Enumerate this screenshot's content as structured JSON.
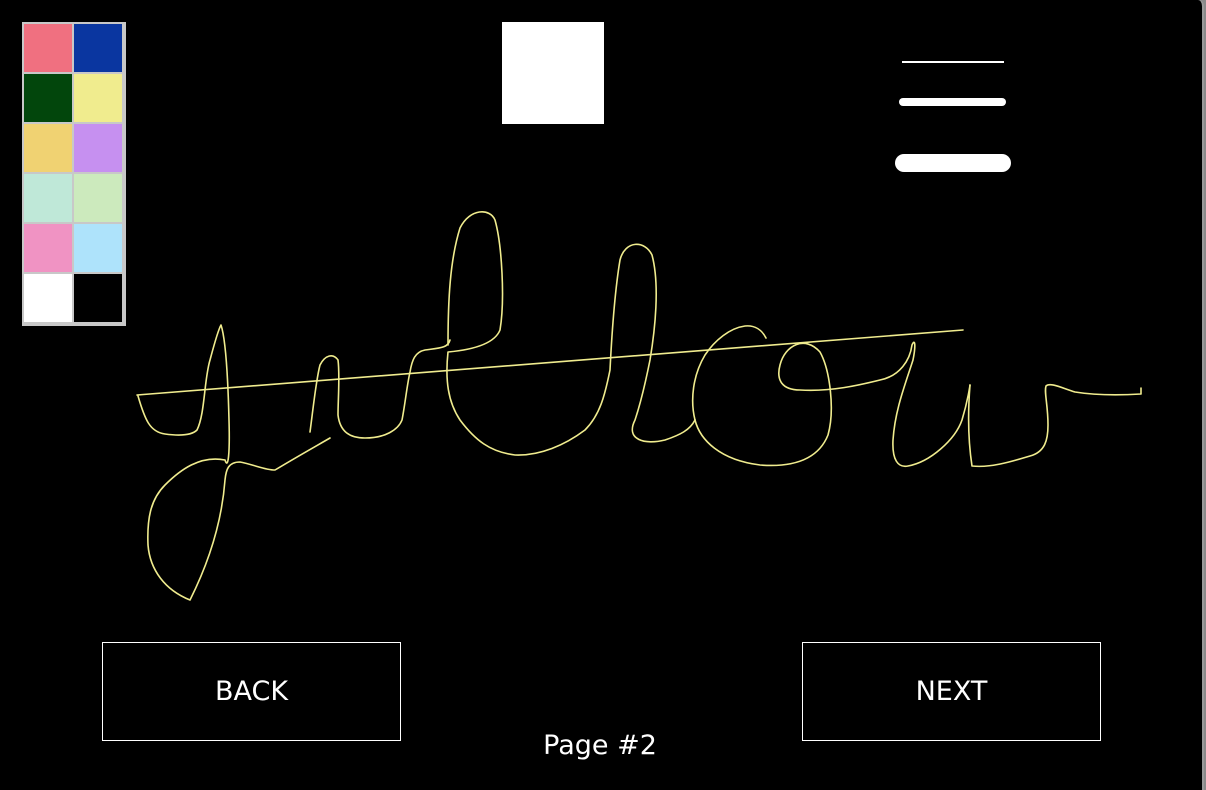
{
  "palette": {
    "colors": [
      "#f07080",
      "#0a36a0",
      "#02460c",
      "#f0ec8e",
      "#f0d272",
      "#c690f0",
      "#bfe8d8",
      "#cceabd",
      "#f093c3",
      "#aee3fb",
      "#ffffff",
      "#000000"
    ]
  },
  "current_color": "#ffffff",
  "stroke_color": "#f0ec8e",
  "buttons": {
    "back_label": "BACK",
    "next_label": "NEXT"
  },
  "page": {
    "label": "Page #2"
  }
}
